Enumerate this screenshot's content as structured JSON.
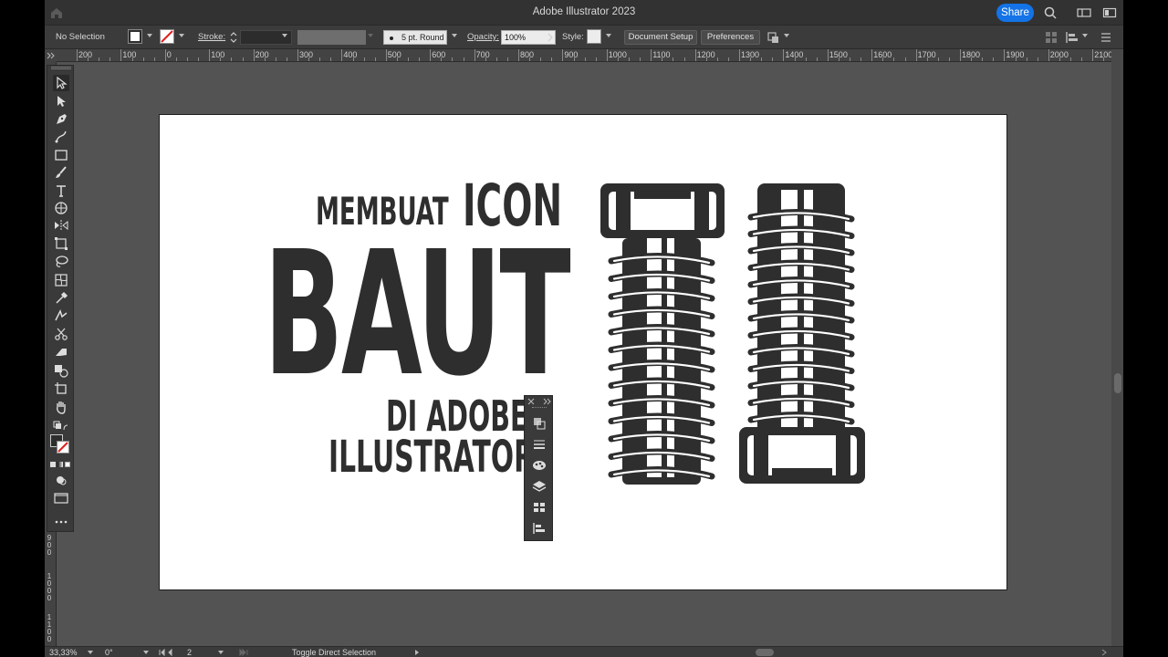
{
  "window": {
    "title": "Adobe Illustrator 2023",
    "share_label": "Share"
  },
  "control_bar": {
    "selection_label": "No Selection",
    "stroke_label": "Stroke:",
    "brush_label": "5 pt. Round",
    "opacity_label": "Opacity:",
    "opacity_value": "100%",
    "style_label": "Style:",
    "document_setup_label": "Document Setup",
    "preferences_label": "Preferences"
  },
  "ruler": {
    "top_ticks": [
      "200",
      "100",
      "0",
      "100",
      "200",
      "300",
      "400",
      "500",
      "600",
      "700",
      "800",
      "900",
      "1000",
      "1100",
      "1200",
      "1300",
      "1400",
      "1500",
      "1600",
      "1700",
      "1800",
      "1900",
      "2000",
      "2100"
    ],
    "left_ticks": [
      "900",
      "1000",
      "1100"
    ]
  },
  "artwork": {
    "line1_small": "MEMBUAT",
    "line1_big": "ICON",
    "main_word": "BAUT",
    "line3": "DI ADOBE",
    "line4": "ILLUSTRATOR"
  },
  "status_bar": {
    "zoom": "33,33%",
    "rotation": "0°",
    "artboard_number": "2",
    "status_text": "Toggle Direct Selection"
  },
  "colors": {
    "share_blue": "#1473e6",
    "artwork_dark": "#2e2e2e",
    "workspace": "#535353"
  }
}
